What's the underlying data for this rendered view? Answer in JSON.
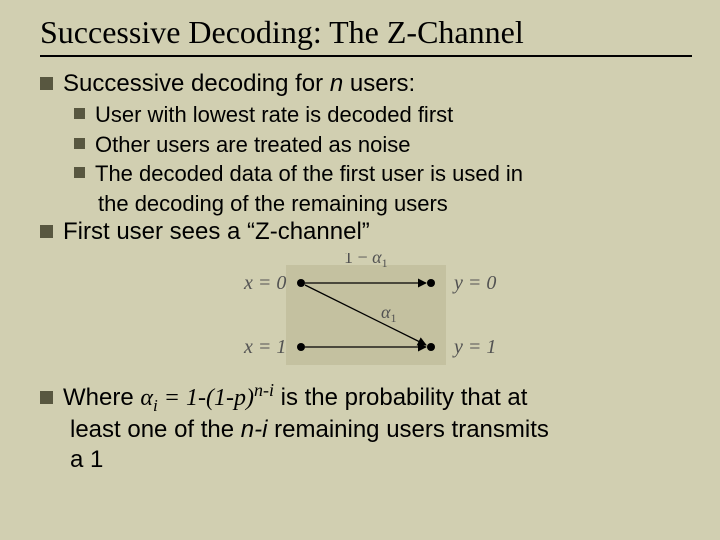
{
  "title": "Successive Decoding: The Z-Channel",
  "b1_pre": "Successive decoding for ",
  "b1_n": "n",
  "b1_post": " users:",
  "b1a": "User with lowest rate is decoded first",
  "b1b": "Other users are treated as noise",
  "b1c_l1": "The decoded data of the first user is used in",
  "b1c_l2": "the decoding of the remaining users",
  "b2": "First user sees a “Z-channel”",
  "b3_pre": "Where ",
  "b3_alpha": "α",
  "b3_sub": "i",
  "b3_eq_pre": " = 1-(1-p)",
  "b3_sup_pre": "n-i",
  "b3_mid": " is the probability that at",
  "b3_l2_pre": "least one of the ",
  "b3_l2_ital": "n-i",
  "b3_l2_post": " remaining users transmits",
  "b3_l3": "a 1",
  "diagram": {
    "x0": "x = 0",
    "x1": "x = 1",
    "y0": "y = 0",
    "y1": "y = 1",
    "top_label_pre": "1 − ",
    "top_label_alpha": "α",
    "top_label_sub": "1",
    "mid_label_alpha": "α",
    "mid_label_sub": "1"
  }
}
